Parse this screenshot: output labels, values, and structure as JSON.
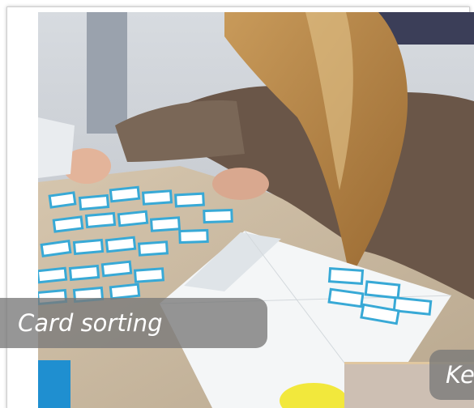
{
  "captions": {
    "primary": "Card sorting",
    "secondary": "Ke"
  },
  "colors": {
    "card_blue": "#38a9d6",
    "caption_bg": "#787878",
    "table": "#c9b8a2"
  }
}
